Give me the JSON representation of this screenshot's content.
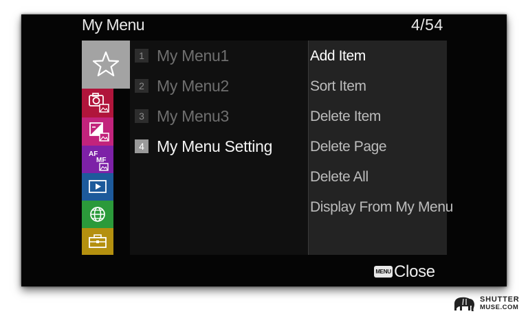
{
  "header": {
    "title": "My Menu",
    "page_indicator": "4/54"
  },
  "categories": [
    {
      "name": "My Menu",
      "icon": "star-icon",
      "color": "#a3a3a3",
      "selected": true
    },
    {
      "name": "Camera 1",
      "icon": "camera-icon",
      "color": "#b0153b"
    },
    {
      "name": "Camera 2",
      "icon": "exposure-icon",
      "color": "#c2237c"
    },
    {
      "name": "AF/MF",
      "icon": "afmf-icon",
      "icon_text_top": "AF",
      "icon_text_bottom": "MF",
      "color": "#7d21a7"
    },
    {
      "name": "Playback",
      "icon": "play-icon",
      "color": "#1d5a9b"
    },
    {
      "name": "Network",
      "icon": "globe-icon",
      "color": "#2b9a3a"
    },
    {
      "name": "Setup",
      "icon": "toolbox-icon",
      "color": "#b4900f"
    }
  ],
  "menu_list": [
    {
      "num": "1",
      "label": "My Menu1"
    },
    {
      "num": "2",
      "label": "My Menu2"
    },
    {
      "num": "3",
      "label": "My Menu3"
    },
    {
      "num": "4",
      "label": "My Menu Setting",
      "active": true
    }
  ],
  "submenu": [
    {
      "label": "Add Item",
      "active": true
    },
    {
      "label": "Sort Item"
    },
    {
      "label": "Delete Item"
    },
    {
      "label": "Delete Page"
    },
    {
      "label": "Delete All"
    },
    {
      "label": "Display From My Menu"
    }
  ],
  "footer": {
    "menu_key": "MENU",
    "close_label": "Close"
  },
  "watermark": {
    "line1": "SHUTTER",
    "line2": "MUSE.COM"
  }
}
